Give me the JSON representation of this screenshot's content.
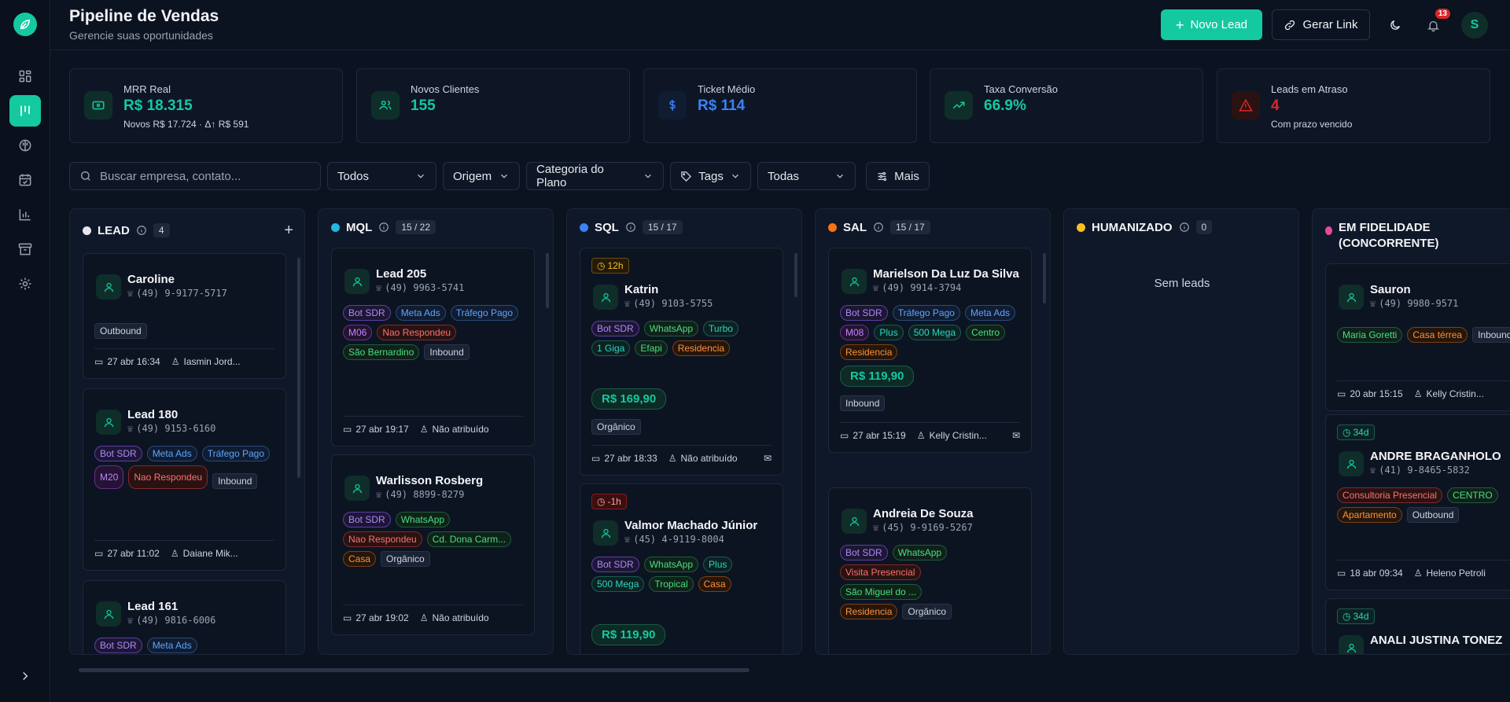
{
  "header": {
    "title": "Pipeline de Vendas",
    "subtitle": "Gerencie suas oportunidades",
    "new_lead": "Novo Lead",
    "generate_link": "Gerar Link",
    "notifications": "13",
    "avatar": "S"
  },
  "stats": [
    {
      "label": "MRR Real",
      "value": "R$ 18.315",
      "sub": "Novos R$ 17.724 · Δ↑ R$ 591",
      "color": "#14c9a0"
    },
    {
      "label": "Novos Clientes",
      "value": "155",
      "sub": "",
      "color": "#14c9a0"
    },
    {
      "label": "Ticket Médio",
      "value": "R$ 114",
      "sub": "",
      "color": "#3b82f6"
    },
    {
      "label": "Taxa Conversão",
      "value": "66.9%",
      "sub": "",
      "color": "#14c9a0"
    },
    {
      "label": "Leads em Atraso",
      "value": "4",
      "sub": "Com prazo vencido",
      "color": "#dc2626"
    }
  ],
  "filters": {
    "search_placeholder": "Buscar empresa, contato...",
    "status": "Todos",
    "origin": "Origem",
    "plan_category": "Categoria do Plano",
    "tags": "Tags",
    "period": "Todas",
    "more": "Mais"
  },
  "columns": [
    {
      "title": "LEAD",
      "count": "4",
      "color": "#e5e7eb"
    },
    {
      "title": "MQL",
      "count": "15 / 22",
      "color": "#22b8e0"
    },
    {
      "title": "SQL",
      "count": "15 / 17",
      "color": "#3b82f6"
    },
    {
      "title": "SAL",
      "count": "15 / 17",
      "color": "#f97316"
    },
    {
      "title": "HUMANIZADO",
      "count": "0",
      "color": "#fbbf24",
      "empty": "Sem leads"
    },
    {
      "title": "EM FIDELIDADE (CONCORRENTE)",
      "count": "",
      "color": "#ec4899"
    }
  ],
  "cards": {
    "lead": [
      {
        "name": "Caroline",
        "phone": "(49) 9-9177-5717",
        "tags": [
          "Outbound"
        ],
        "date": "27 abr 16:34",
        "owner": "Iasmin Jord..."
      },
      {
        "name": "Lead 180",
        "phone": "(49) 9153-6160",
        "tags": [
          "Bot SDR",
          "Meta Ads",
          "Tráfego Pago",
          "M20",
          "Nao Respondeu",
          "Inbound"
        ],
        "date": "27 abr 11:02",
        "owner": "Daiane Mik..."
      },
      {
        "name": "Lead 161",
        "phone": "(49) 9816-6006",
        "tags": [
          "Bot SDR",
          "Meta Ads"
        ]
      }
    ],
    "mql": [
      {
        "name": "Lead 205",
        "phone": "(49) 9963-5741",
        "tags": [
          "Bot SDR",
          "Meta Ads",
          "Tráfego Pago",
          "M06",
          "Nao Respondeu",
          "São Bernardino",
          "Inbound"
        ],
        "date": "27 abr 19:17",
        "owner": "Não atribuído"
      },
      {
        "name": "Warlisson Rosberg",
        "phone": "(49) 8899-8279",
        "tags": [
          "Bot SDR",
          "WhatsApp",
          "Nao Respondeu",
          "Cd. Dona Carm...",
          "Casa",
          "Orgânico"
        ],
        "date": "27 abr 19:02",
        "owner": "Não atribuído"
      }
    ],
    "sql": [
      {
        "time": "12h",
        "name": "Katrin",
        "phone": "(49) 9103-5755",
        "tags": [
          "Bot SDR",
          "WhatsApp",
          "Turbo",
          "1 Giga",
          "Efapi",
          "Residencia"
        ],
        "price": "R$ 169,90",
        "origin": "Orgânico",
        "date": "27 abr 18:33",
        "owner": "Não atribuído"
      },
      {
        "time": "-1h",
        "name": "Valmor Machado Júnior",
        "phone": "(45) 4-9119-8004",
        "tags": [
          "Bot SDR",
          "WhatsApp",
          "Plus",
          "500 Mega",
          "Tropical",
          "Casa"
        ],
        "price": "R$ 119,90"
      }
    ],
    "sal": [
      {
        "name": "Marielson Da Luz Da Silva",
        "phone": "(49) 9914-3794",
        "tags": [
          "Bot SDR",
          "Tráfego Pago",
          "Meta Ads",
          "M08",
          "Plus",
          "500 Mega",
          "Centro",
          "Residencia"
        ],
        "price": "R$ 119,90",
        "origin": "Inbound",
        "date": "27 abr 15:19",
        "owner": "Kelly Cristin..."
      },
      {
        "name": "Andreia De Souza",
        "phone": "(45) 9-9169-5267",
        "tags": [
          "Bot SDR",
          "WhatsApp",
          "Visita Presencial",
          "São Miguel do ...",
          "Residencia",
          "Orgânico"
        ]
      }
    ],
    "fidelidade": [
      {
        "name": "Sauron",
        "phone": "(49) 9980-9571",
        "tags": [
          "Maria Goretti",
          "Casa térrea",
          "Inbound"
        ],
        "date": "20 abr 15:15",
        "owner": "Kelly Cristin..."
      },
      {
        "time": "34d",
        "name": "ANDRE BRAGANHOLO",
        "phone": "(41) 9-8465-5832",
        "tags": [
          "Consultoria Presencial",
          "CENTRO",
          "Apartamento",
          "Outbound"
        ],
        "date": "18 abr 09:34",
        "owner": "Heleno Petroli"
      },
      {
        "time": "34d",
        "name": "ANALI JUSTINA TONEZ"
      }
    ]
  }
}
